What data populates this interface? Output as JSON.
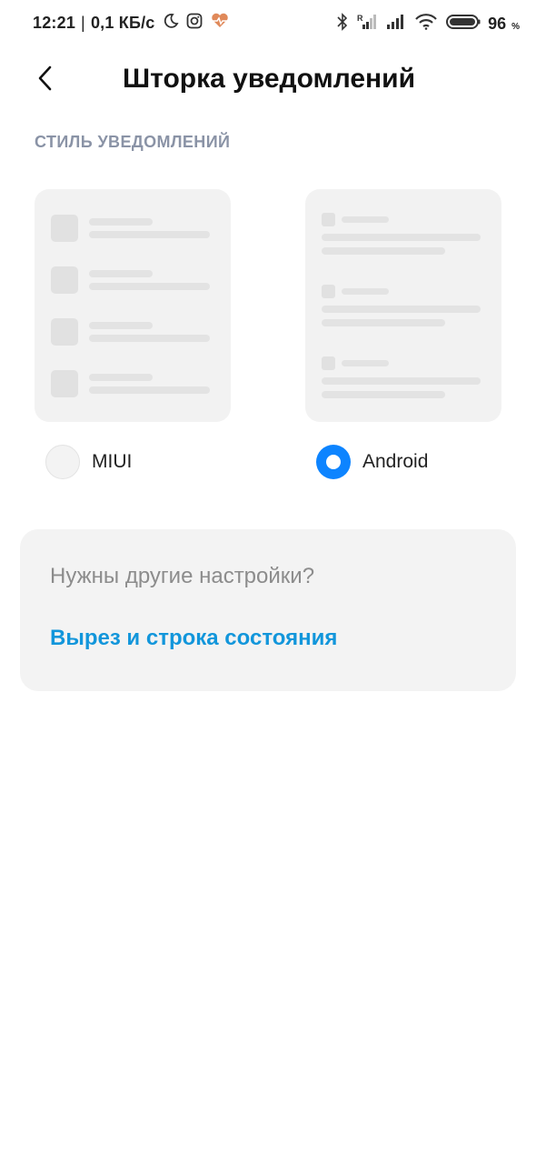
{
  "status_bar": {
    "time": "12:21",
    "network_speed": "0,1 КБ/с",
    "separator": "|",
    "battery_percent": "96",
    "percent_sign": "%",
    "left_icons": [
      "moon-icon",
      "instagram-icon",
      "health-heart-icon"
    ],
    "right_icons": [
      "bluetooth-icon",
      "signal-roaming-icon",
      "signal-icon",
      "wifi-icon",
      "battery-icon"
    ]
  },
  "header": {
    "back_icon": "chevron-left-icon",
    "title": "Шторка уведомлений"
  },
  "section": {
    "label": "СТИЛЬ УВЕДОМЛЕНИЙ"
  },
  "style_options": [
    {
      "label": "MIUI",
      "selected": false
    },
    {
      "label": "Android",
      "selected": true
    }
  ],
  "card": {
    "heading": "Нужны другие настройки?",
    "link": "Вырез и строка состояния"
  },
  "colors": {
    "accent_blue": "#0d84ff",
    "link_blue": "#1296db",
    "section_label": "#8a93a6",
    "card_bg": "#f3f3f3",
    "preview_bg": "#f2f2f2",
    "health_icon": "#e0895a"
  }
}
